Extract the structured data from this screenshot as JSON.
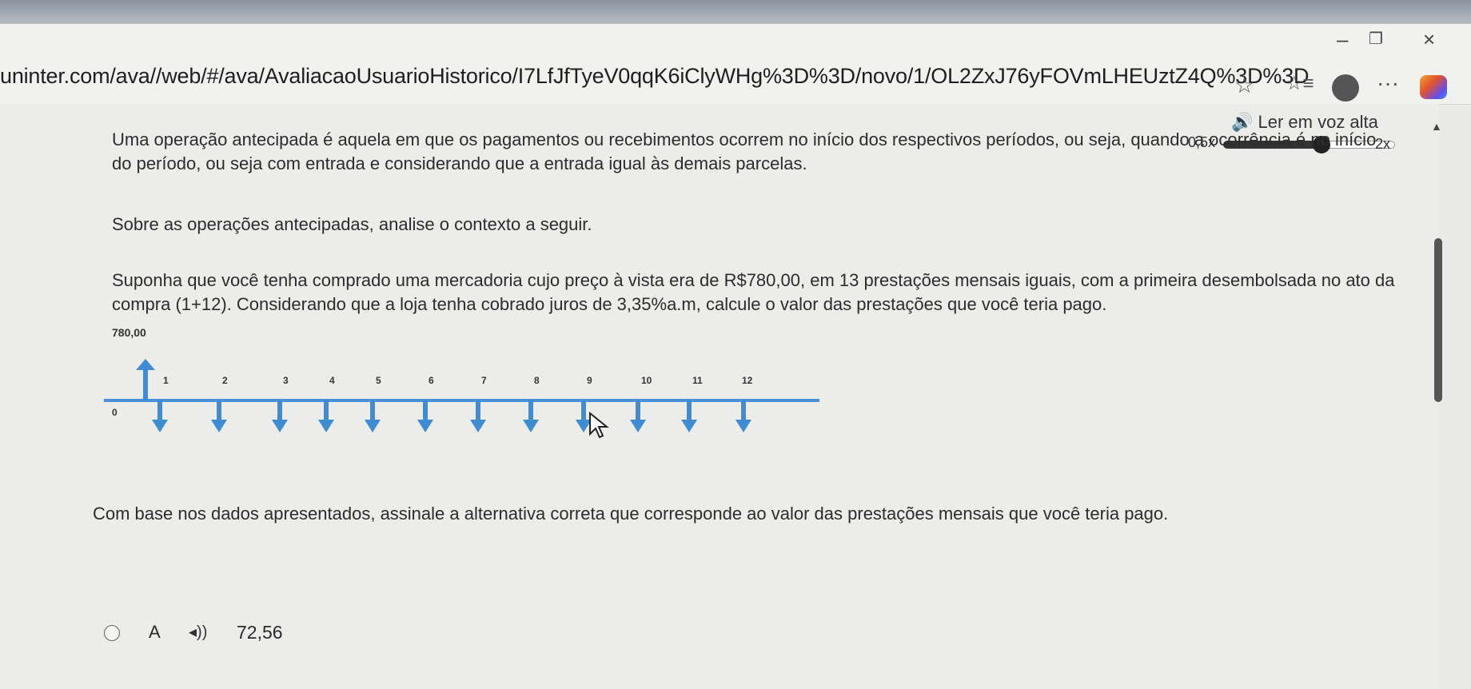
{
  "browser": {
    "url": "uninter.com/ava//web/#/ava/AvaliacaoUsuarioHistorico/I7LfJfTyeV0qqK6iClyWHg%3D%3D/novo/1/OL2ZxJ76yFOVmLHEUztZ4Q%3D%3D",
    "menu_glyph": "···"
  },
  "read_aloud": {
    "label": "🔊 Ler em voz alta",
    "rate_min": "0,5x",
    "rate_max": "2x"
  },
  "question": {
    "intro": "Uma operação antecipada é aquela em que os pagamentos ou recebimentos ocorrem no início dos respectivos períodos, ou seja, quando a ocorrência é no início do período, ou seja com entrada e considerando que a entrada igual às demais parcelas.",
    "prompt": "Sobre as operações antecipadas, analise o contexto a seguir.",
    "scenario": "Suponha que você tenha comprado uma mercadoria cujo preço à vista era de R$780,00, em 13 prestações mensais iguais, com a primeira desembolsada no ato da compra (1+12). Considerando que a loja tenha cobrado juros de 3,35%a.m, calcule o valor das prestações que você teria pago.",
    "instruction": "Com base nos dados apresentados, assinale a alternativa correta que corresponde ao valor das prestações mensais que você teria pago."
  },
  "cashflow": {
    "present_value_label": "780,00",
    "periods": [
      "0",
      "1",
      "2",
      "3",
      "4",
      "5",
      "6",
      "7",
      "8",
      "9",
      "10",
      "11",
      "12"
    ],
    "colors": {
      "arrow": "#3f8bd4",
      "line": "#4a90d9"
    }
  },
  "options": [
    {
      "letter": "A",
      "value": "72,56"
    }
  ]
}
